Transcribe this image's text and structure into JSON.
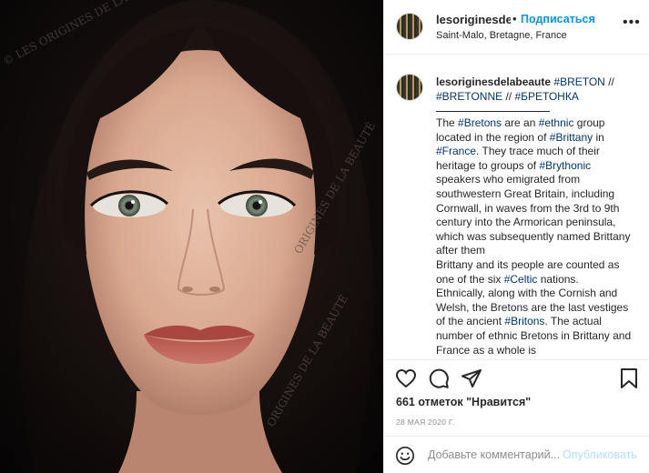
{
  "photo": {
    "watermark": "© LES ORIGINES DE LA BEAUTÉ",
    "watermark_bottom": "ORIGINES DE LA BEAUTÉ"
  },
  "header": {
    "username": "lesoriginesdelabeaute",
    "separator": "•",
    "follow_label": "Подписаться",
    "location": "Saint-Malo, Bretagne, France",
    "more_icon": "ellipsis-icon"
  },
  "caption": {
    "username": "lesoriginesdelabeaute",
    "title_parts": [
      {
        "text": "#BRETON",
        "tag": true
      },
      {
        "text": " // ",
        "tag": false
      },
      {
        "text": "#BRETONNE",
        "tag": true
      },
      {
        "text": " // ",
        "tag": false
      },
      {
        "text": "#БРЕТОНКА",
        "tag": true
      }
    ],
    "body_parts": [
      {
        "text": "The ",
        "tag": false
      },
      {
        "text": "#Bretons",
        "tag": true
      },
      {
        "text": " are an ",
        "tag": false
      },
      {
        "text": "#ethnic",
        "tag": true
      },
      {
        "text": " group located in the region of ",
        "tag": false
      },
      {
        "text": "#Brittany",
        "tag": true
      },
      {
        "text": " in ",
        "tag": false
      },
      {
        "text": "#France",
        "tag": true
      },
      {
        "text": ". They trace much of their heritage to groups of ",
        "tag": false
      },
      {
        "text": "#Brythonic",
        "tag": true
      },
      {
        "text": " speakers who emigrated from southwestern Great Britain, including Cornwall, in waves from the 3rd to 9th century into the Armorican peninsula, which was subsequently named Brittany after them",
        "tag": false
      },
      {
        "text": "\n",
        "tag": false
      },
      {
        "text": "Brittany and its people are counted as one of the six ",
        "tag": false
      },
      {
        "text": "#Celtic",
        "tag": true
      },
      {
        "text": " nations.",
        "tag": false
      },
      {
        "text": "\n",
        "tag": false
      },
      {
        "text": "Ethnically, along with the Cornish and Welsh, the Bretons are the last vestiges of the ancient ",
        "tag": false
      },
      {
        "text": "#Britons",
        "tag": true
      },
      {
        "text": ". The actual number of ethnic Bretons in Brittany and France as a whole is",
        "tag": false
      }
    ]
  },
  "actions": {
    "like_icon": "heart-icon",
    "comment_icon": "comment-icon",
    "share_icon": "share-icon",
    "save_icon": "bookmark-icon"
  },
  "likes": "661 отметок \"Нравится\"",
  "date": "28 МАЯ 2020 Г.",
  "comment": {
    "emoji_icon": "emoji-icon",
    "placeholder": "Добавьте комментарий...",
    "publish_label": "Опубликовать"
  },
  "colors": {
    "accent": "#0095f6",
    "tag": "#00376b",
    "publish_disabled": "#b2dffc",
    "muted": "#8e8e8e"
  }
}
